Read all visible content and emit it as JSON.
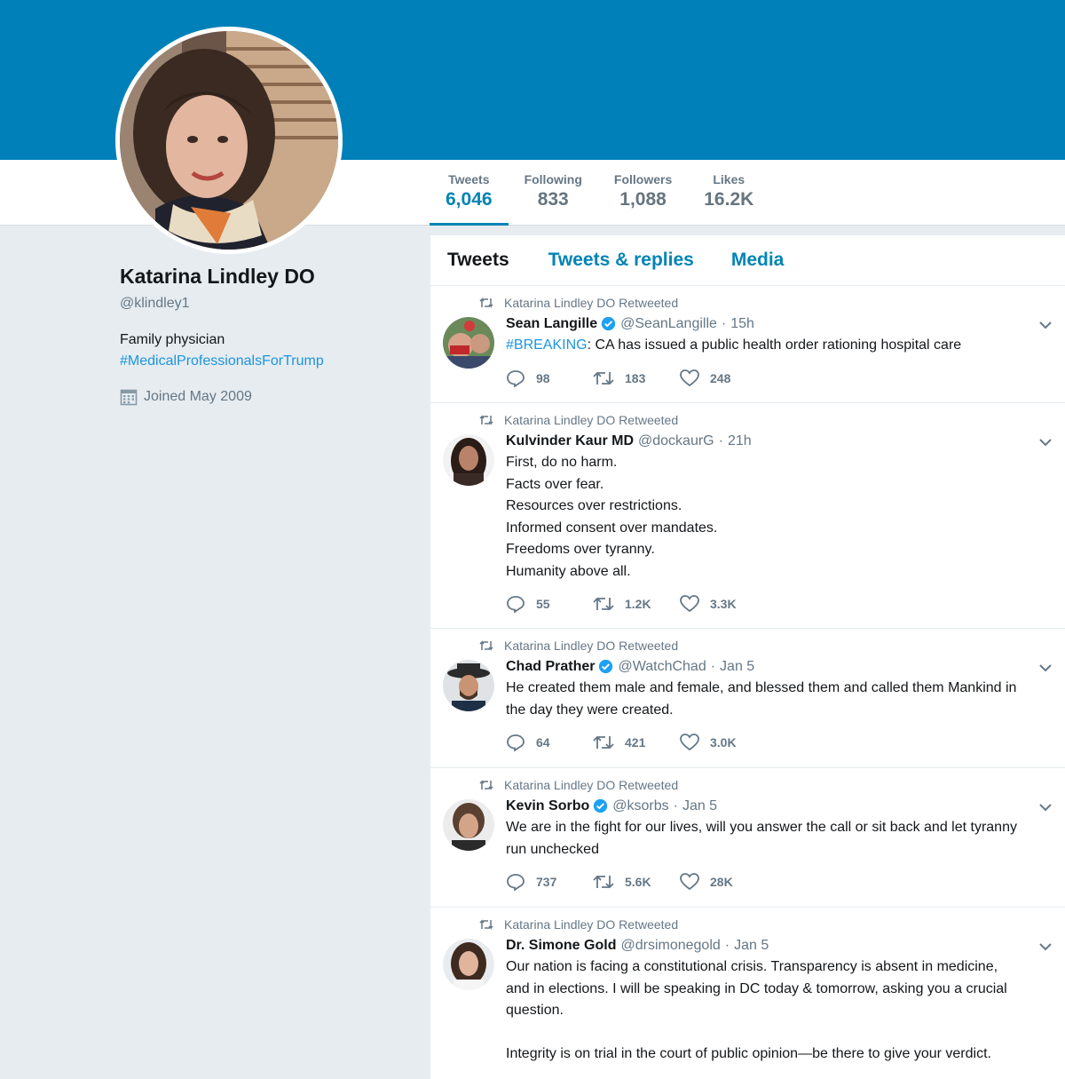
{
  "profile": {
    "name": "Katarina Lindley DO",
    "handle": "@klindley1",
    "bio_line": "Family physician",
    "bio_hashtag": "#MedicalProfessionalsForTrump",
    "joined": "Joined May 2009"
  },
  "stats": [
    {
      "label": "Tweets",
      "value": "6,046"
    },
    {
      "label": "Following",
      "value": "833"
    },
    {
      "label": "Followers",
      "value": "1,088"
    },
    {
      "label": "Likes",
      "value": "16.2K"
    }
  ],
  "tabs": [
    "Tweets",
    "Tweets & replies",
    "Media"
  ],
  "retweet_label": "Katarina Lindley DO Retweeted",
  "tweets": [
    {
      "name": "Sean Langille",
      "handle": "@SeanLangille",
      "time": "15h",
      "hashtag": "#BREAKING",
      "text": ": CA has issued a public health order rationing hospital care",
      "replies": "98",
      "retweets": "183",
      "likes": "248"
    },
    {
      "name": "Kulvinder Kaur MD",
      "handle": "@dockaurG",
      "time": "21h",
      "lines": [
        "First, do no harm.",
        "Facts over fear.",
        "Resources over restrictions.",
        "Informed consent over mandates.",
        "Freedoms over tyranny.",
        "Humanity above all."
      ],
      "replies": "55",
      "retweets": "1.2K",
      "likes": "3.3K"
    },
    {
      "name": "Chad Prather",
      "handle": "@WatchChad",
      "time": "Jan 5",
      "lines": [
        "He created them male and female, and blessed them and called them Mankind in",
        "the day they were created."
      ],
      "replies": "64",
      "retweets": "421",
      "likes": "3.0K"
    },
    {
      "name": "Kevin Sorbo",
      "handle": "@ksorbs",
      "time": "Jan 5",
      "lines": [
        "We are in the fight for our lives, will you answer the call or sit back and let tyranny",
        "run unchecked"
      ],
      "replies": "737",
      "retweets": "5.6K",
      "likes": "28K"
    },
    {
      "name": "Dr. Simone Gold",
      "handle": "@drsimonegold",
      "time": "Jan 5",
      "lines": [
        "Our nation is facing a constitutional crisis. Transparency is absent in medicine,",
        "and in elections. I will be speaking in DC today & tomorrow, asking you a crucial",
        "question.",
        "",
        "Integrity is on trial in the court of public opinion—be there to give your verdict."
      ]
    }
  ],
  "icons": {
    "retweet": "retweet-icon",
    "reply": "reply-icon",
    "like": "heart-icon",
    "verified": "verified-badge-icon",
    "caret": "chevron-down-icon",
    "calendar": "calendar-icon"
  },
  "colors": {
    "banner": "#0080b8",
    "link": "#1b95e0",
    "accent": "#0084b4",
    "muted": "#657786",
    "background": "#e6ecf0"
  }
}
